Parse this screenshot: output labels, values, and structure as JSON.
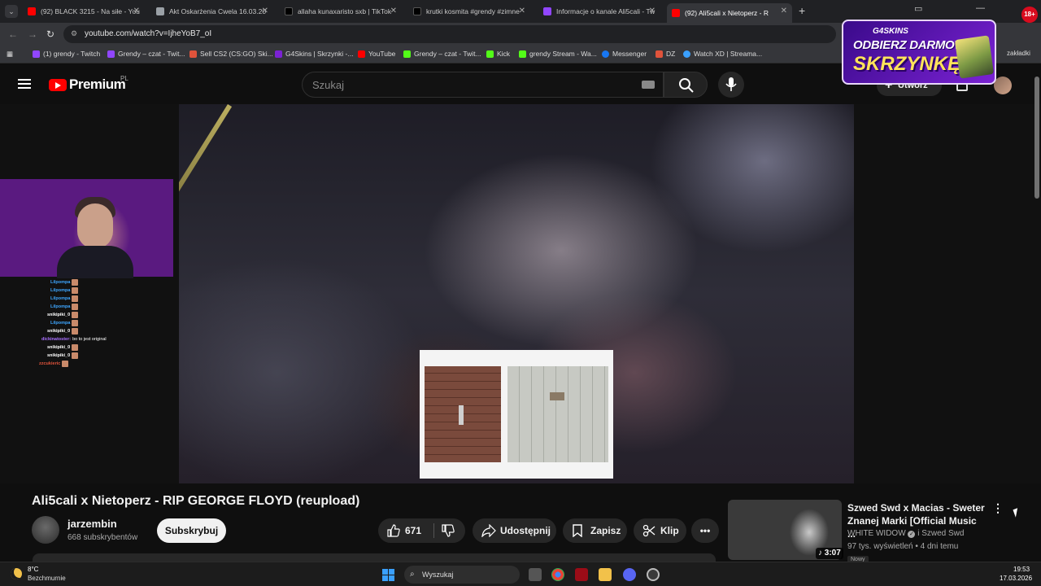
{
  "browser": {
    "tabs": [
      {
        "title": "(92) BLACK 3215 - Na siłe - You",
        "icon_color": "#ff0000"
      },
      {
        "title": "Akt Oskarżenia Cwela 16.03.20",
        "icon_color": "#9aa0a6"
      },
      {
        "title": "allaha kunaxaristo sxb | TikTok",
        "icon_color": "#111111"
      },
      {
        "title": "krutki kosmita #grendy #zimne",
        "icon_color": "#111111"
      },
      {
        "title": "Informacje o kanale Ali5cali - Tw",
        "icon_color": "#9146ff"
      },
      {
        "title": "(92) Ali5cali x Nietoperz - R",
        "icon_color": "#ff0000"
      }
    ],
    "url": "youtube.com/watch?v=IjheYoB7_oI",
    "bookmarks": [
      {
        "label": "(1) grendy - Twitch",
        "color": "#9146ff"
      },
      {
        "label": "Grendy – czat - Twit...",
        "color": "#9146ff"
      },
      {
        "label": "Sell CS2 (CS:GO) Ski...",
        "color": "#e0533b"
      },
      {
        "label": "G4Skins | Skrzynki -...",
        "color": "#7b22d4"
      },
      {
        "label": "YouTube",
        "color": "#ff0000"
      },
      {
        "label": "Grendy – czat - Twit...",
        "color": "#53fc18"
      },
      {
        "label": "Kick",
        "color": "#53fc18"
      },
      {
        "label": "grendy Stream - Wa...",
        "color": "#53fc18"
      },
      {
        "label": "Messenger",
        "color": "#1877f2"
      },
      {
        "label": "DZ",
        "color": "#e0533b"
      },
      {
        "label": "Watch XD | Streama...",
        "color": "#3aa0ff"
      }
    ],
    "bookmarks_tail": "zakładki"
  },
  "youtube": {
    "logo_word": "Premium",
    "country": "PL",
    "search_placeholder": "Szukaj",
    "create_label": "Utwórz"
  },
  "ad": {
    "brand": "G4SKINS",
    "line1": "ODBIERZ DARMOWĄ",
    "line2": "SKRZYNKĘ!",
    "age_badge": "18+"
  },
  "chat": [
    {
      "user": "Lilpompa",
      "color": "#3ea6ff",
      "msg": ""
    },
    {
      "user": "Lilpompa",
      "color": "#3ea6ff",
      "msg": ""
    },
    {
      "user": "Lilpompa",
      "color": "#3ea6ff",
      "msg": ""
    },
    {
      "user": "Lilpompa",
      "color": "#3ea6ff",
      "msg": ""
    },
    {
      "user": "snikipiki_0",
      "color": "#ffffff",
      "msg": ""
    },
    {
      "user": "Lilpompa",
      "color": "#3ea6ff",
      "msg": ""
    },
    {
      "user": "snikipiki_0",
      "color": "#ffffff",
      "msg": ""
    },
    {
      "user": "dickinatoster:",
      "color": "#a970ff",
      "msg": "bo to jest original"
    },
    {
      "user": "snikipiki_0",
      "color": "#ffffff",
      "msg": ""
    },
    {
      "user": "snikipiki_0",
      "color": "#ffffff",
      "msg": ""
    },
    {
      "user": "zzcukieric",
      "color": "#e0533b",
      "msg": ""
    }
  ],
  "video": {
    "title": "Ali5cali x Nietoperz - RIP GEORGE FLOYD (reupload)",
    "channel": "jarzembin",
    "subscribers": "668 subskrybentów",
    "subscribe_label": "Subskrybuj",
    "likes": "671",
    "share_label": "Udostępnij",
    "save_label": "Zapisz",
    "clip_label": "Klip"
  },
  "recommendation": {
    "title": "Szwed Swd x Macias - Sweter Znanej Marki [Official Music ...",
    "channel": "WHITE WIDOW",
    "channel_extra": "i Szwed Swd",
    "meta": "97 tys. wyświetleń • 4 dni temu",
    "duration": "3:07",
    "badge": "Nowy"
  },
  "taskbar": {
    "temperature": "8°C",
    "weather": "Bezchmurnie",
    "search_label": "Wyszukaj",
    "time": "19:53",
    "date": "17.03.2026"
  }
}
